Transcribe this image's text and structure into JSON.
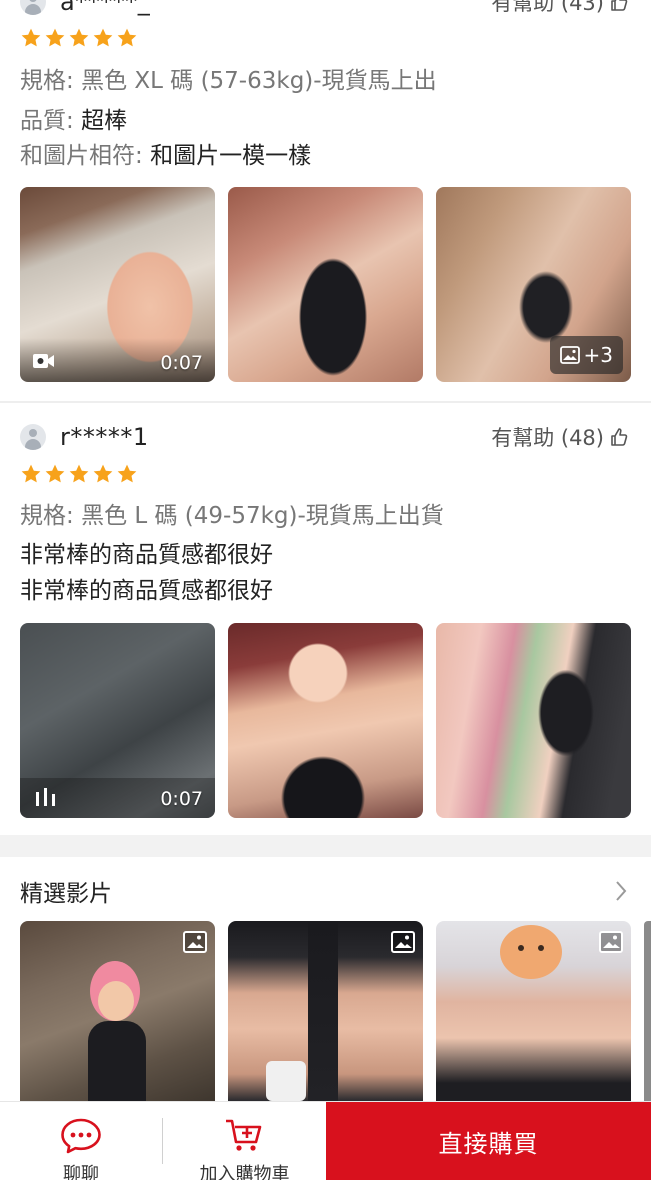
{
  "reviews": [
    {
      "username": "a*****_",
      "helpful_label": "有幫助 (43)",
      "rating": 5,
      "spec_label": "規格:",
      "spec_value": "黑色 XL 碼 (57-63kg)-現貨馬上出",
      "quality_label": "品質:",
      "quality_value": "超棒",
      "match_label": "和圖片相符:",
      "match_value": "和圖片一模一樣",
      "media": [
        {
          "type": "video",
          "duration": "0:07"
        },
        {
          "type": "image"
        },
        {
          "type": "image",
          "more_count": "+3"
        }
      ]
    },
    {
      "username": "r*****1",
      "helpful_label": "有幫助 (48)",
      "rating": 5,
      "spec_label": "規格:",
      "spec_value": "黑色 L 碼 (49-57kg)-現貨馬上出貨",
      "comment_lines": [
        "非常棒的商品質感都很好",
        "非常棒的商品質感都很好"
      ],
      "media": [
        {
          "type": "video",
          "duration": "0:07"
        },
        {
          "type": "image"
        },
        {
          "type": "image"
        }
      ]
    }
  ],
  "featured": {
    "title": "精選影片",
    "items": [
      {
        "icon": "image-icon"
      },
      {
        "icon": "image-icon"
      },
      {
        "icon": "image-icon"
      }
    ]
  },
  "bottom_bar": {
    "chat_label": "聊聊",
    "cart_label": "加入購物車",
    "buy_label": "直接購買"
  },
  "colors": {
    "accent": "#d8111d",
    "star": "#f7a21b",
    "muted_text": "#777777"
  }
}
